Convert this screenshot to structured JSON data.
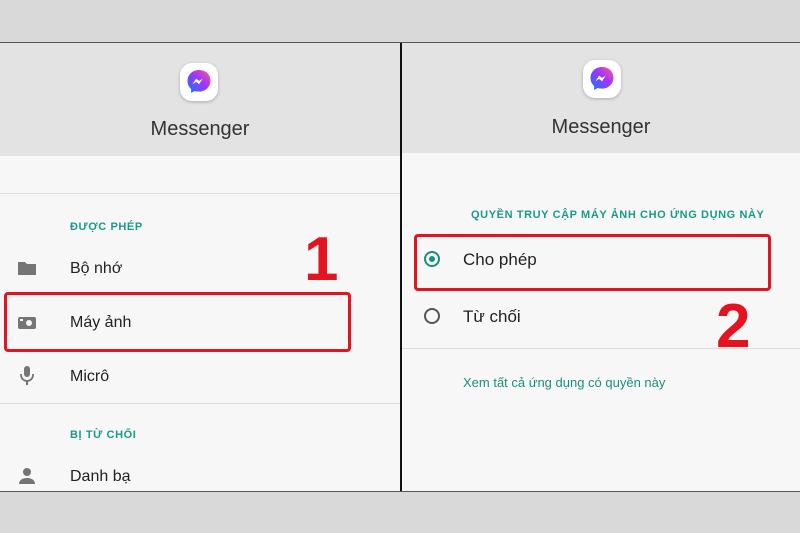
{
  "left_panel": {
    "app_name": "Messenger",
    "allowed_section": "ĐƯỢC PHÉP",
    "allowed_items": [
      {
        "label": "Bộ nhớ",
        "icon": "folder-icon"
      },
      {
        "label": "Máy ảnh",
        "icon": "camera-icon"
      },
      {
        "label": "Micrô",
        "icon": "microphone-icon"
      }
    ],
    "denied_section": "BỊ TỪ CHỐI",
    "denied_items": [
      {
        "label": "Danh bạ",
        "icon": "person-icon"
      }
    ],
    "step_number": "1"
  },
  "right_panel": {
    "app_name": "Messenger",
    "section_title": "QUYỀN TRUY CẬP MÁY ẢNH CHO ỨNG DỤNG NÀY",
    "options": [
      {
        "label": "Cho phép",
        "selected": true
      },
      {
        "label": "Từ chối",
        "selected": false
      }
    ],
    "see_all_link": "Xem tất cả ứng dụng có quyền này",
    "step_number": "2"
  },
  "colors": {
    "accent": "#1a9a8a",
    "highlight": "#e3141f",
    "header_bg": "#e3e3e3"
  }
}
